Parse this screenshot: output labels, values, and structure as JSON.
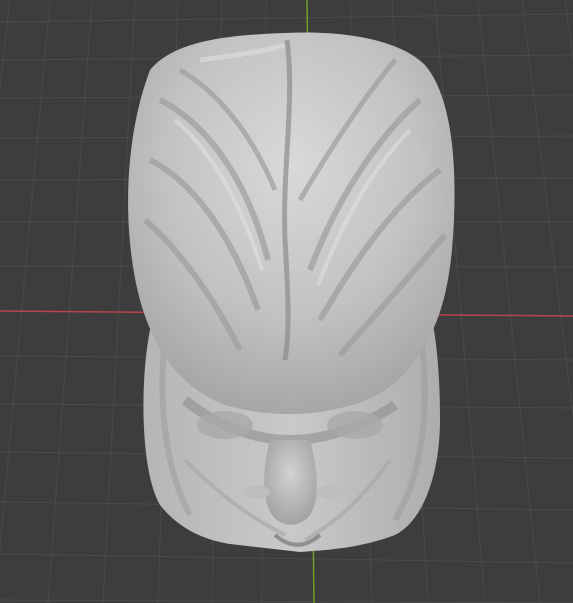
{
  "viewport": {
    "background_color": "#3d3d3d",
    "grid_line_color": "#4a4a4a",
    "x_axis_color": "#b8424f",
    "y_axis_color": "#6f9d29",
    "model_base_color": "#c3c3c3",
    "model_shadow_color": "#8f8f8f",
    "model_highlight_color": "#e1e1e1"
  },
  "scene": {
    "object": "sculpted-head-bust",
    "view": "perspective"
  }
}
